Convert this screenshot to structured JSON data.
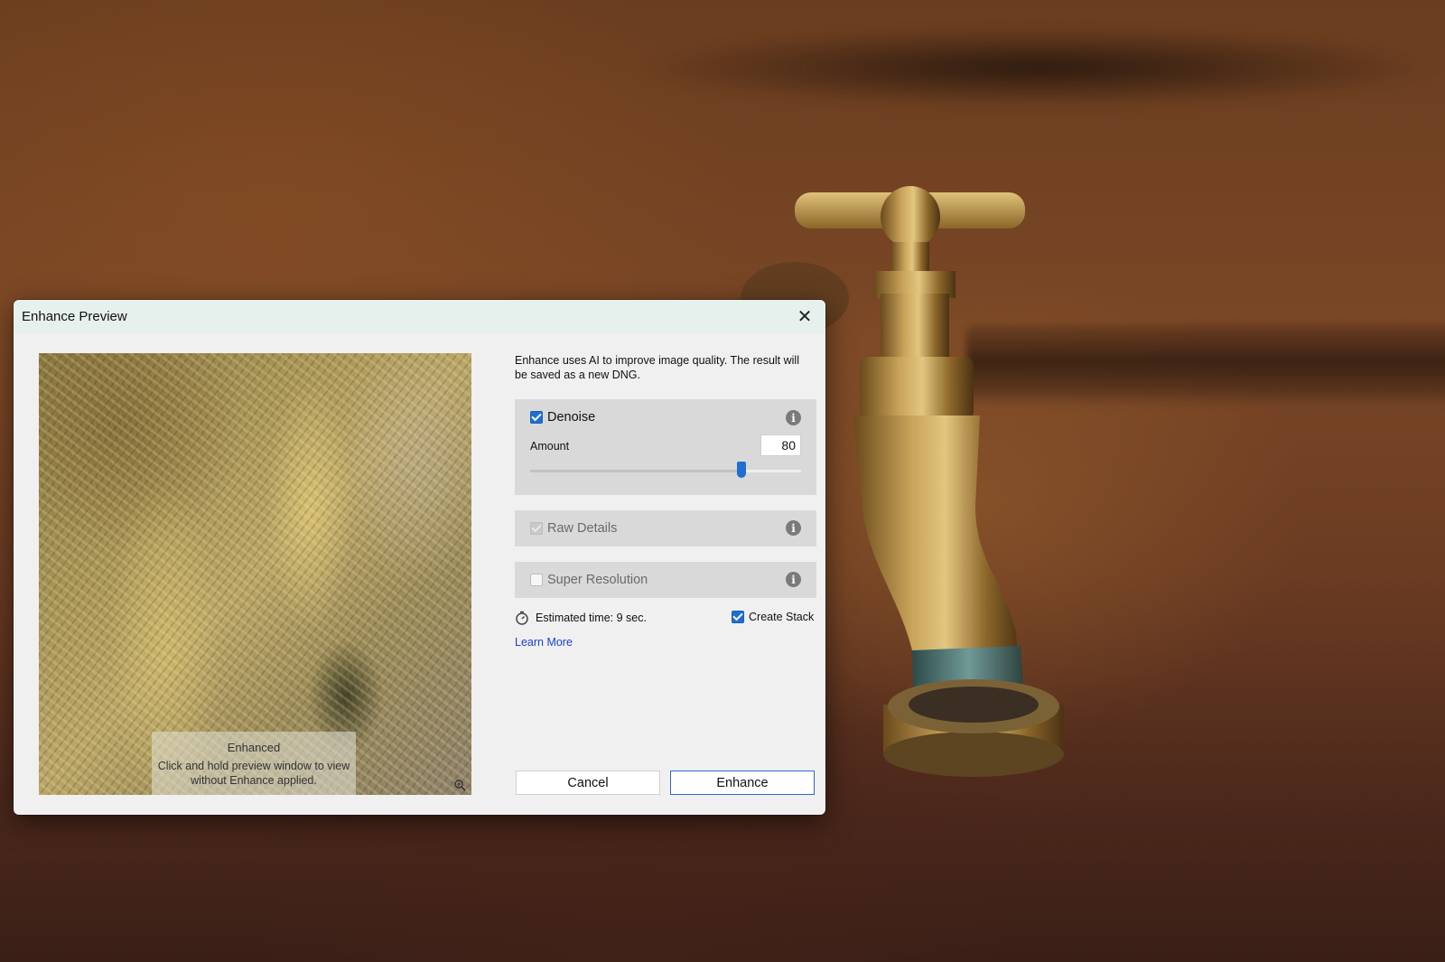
{
  "dialog": {
    "title": "Enhance Preview",
    "close_symbol": "✕",
    "intro": "Enhance uses AI to improve image quality. The result will be saved as a new DNG."
  },
  "preview": {
    "status": "Enhanced",
    "hint": "Click and hold preview window to view without Enhance applied.",
    "zoom_icon": "zoom-icon"
  },
  "options": {
    "denoise": {
      "label": "Denoise",
      "checked": true,
      "amount_label": "Amount",
      "amount_value": "80",
      "amount_fraction": 0.78
    },
    "raw_details": {
      "label": "Raw Details",
      "checked": true,
      "disabled": true
    },
    "super_resolution": {
      "label": "Super Resolution",
      "checked": false
    },
    "info_symbol": "i"
  },
  "footer": {
    "estimated_time": "Estimated time: 9 sec.",
    "create_stack_label": "Create Stack",
    "create_stack_checked": true,
    "learn_more": "Learn More",
    "cancel_label": "Cancel",
    "enhance_label": "Enhance"
  },
  "colors": {
    "accent": "#1f6fd1",
    "link": "#1b3fd1",
    "titlebar": "#e6f1ee",
    "dialog_bg": "#f0f0f0",
    "panel_bg": "#d9d9d9"
  }
}
